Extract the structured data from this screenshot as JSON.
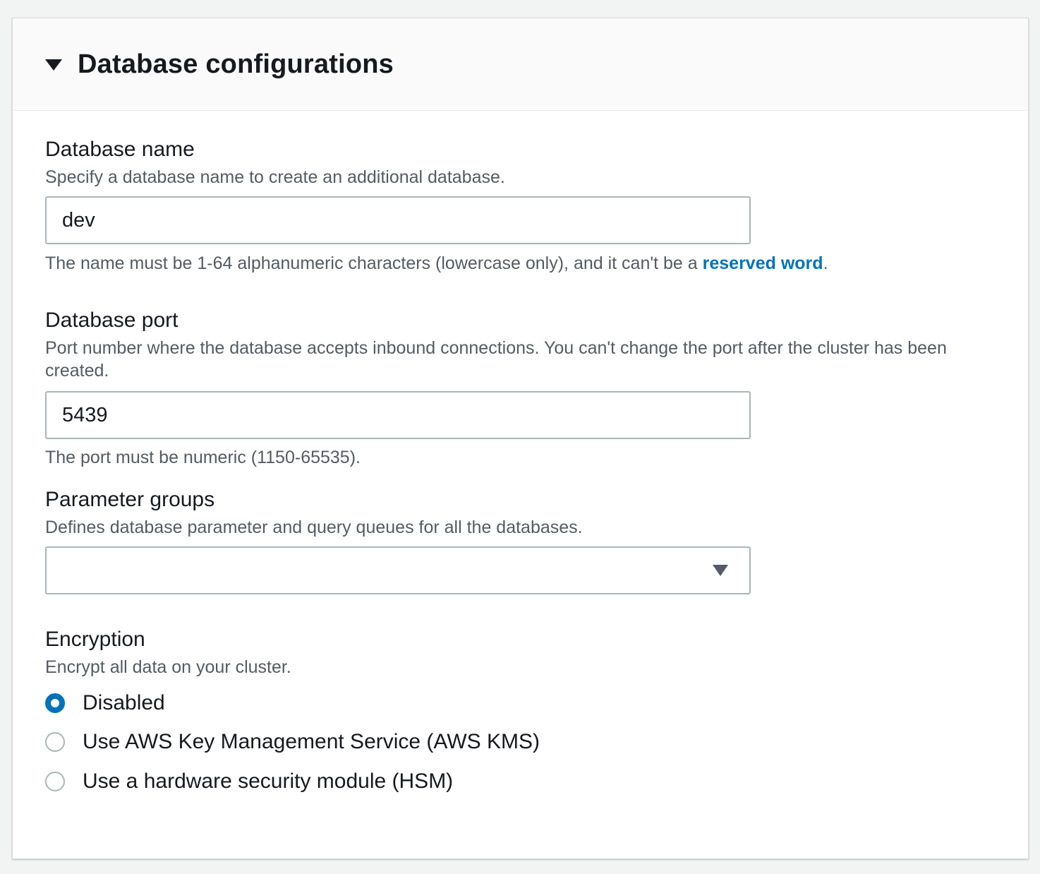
{
  "panel": {
    "title": "Database configurations"
  },
  "database_name": {
    "label": "Database name",
    "description": "Specify a database name to create an additional database.",
    "value": "dev",
    "hint_text": "The name must be 1-64 alphanumeric characters (lowercase only), and it can't be a ",
    "hint_link": "reserved word",
    "hint_suffix": "."
  },
  "database_port": {
    "label": "Database port",
    "description": "Port number where the database accepts inbound connections. You can't change the port after the cluster has been created.",
    "value": "5439",
    "hint_text": "The port must be numeric (1150-65535)."
  },
  "parameter_groups": {
    "label": "Parameter groups",
    "description": "Defines database parameter and query queues for all the databases.",
    "selected": ""
  },
  "encryption": {
    "label": "Encryption",
    "description": "Encrypt all data on your cluster.",
    "options": [
      {
        "label": "Disabled",
        "checked": true
      },
      {
        "label": "Use AWS Key Management Service (AWS KMS)",
        "checked": false
      },
      {
        "label": "Use a hardware security module (HSM)",
        "checked": false
      }
    ]
  },
  "colors": {
    "accent": "#0073bb",
    "border": "#aab7b8",
    "muted_text": "#545b64"
  },
  "icons": {
    "collapse": "caret-down-icon",
    "select": "caret-down-icon"
  }
}
